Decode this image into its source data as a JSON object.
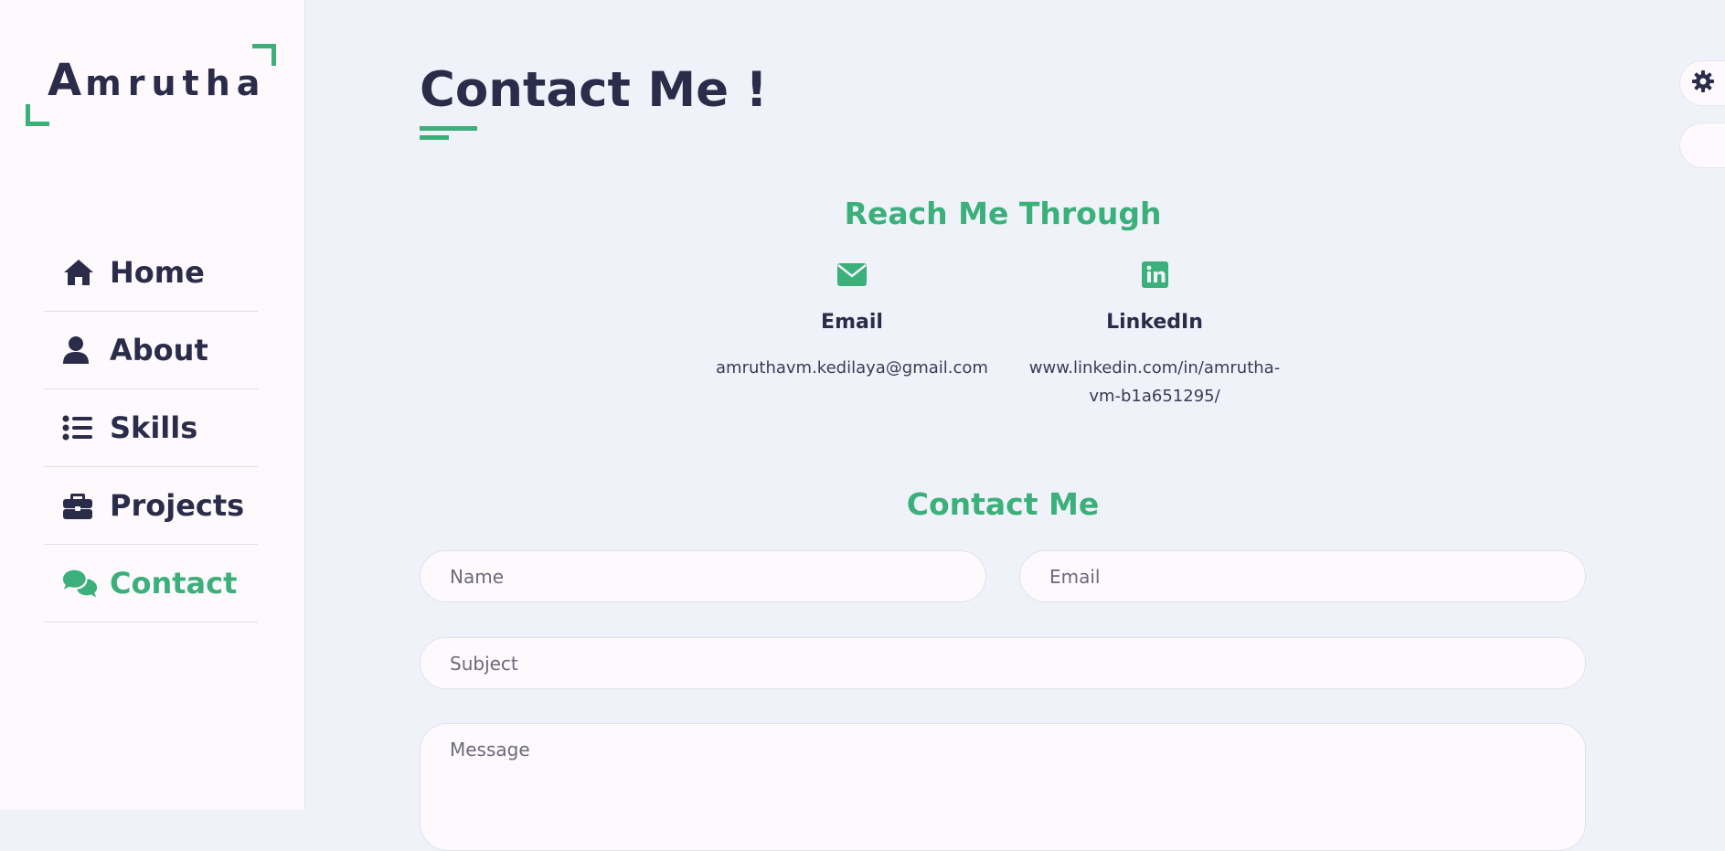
{
  "logo": {
    "first_letter": "A",
    "rest": "mrutha"
  },
  "nav": {
    "items": [
      {
        "label": "Home",
        "icon": "home-icon"
      },
      {
        "label": "About",
        "icon": "user-icon"
      },
      {
        "label": "Skills",
        "icon": "list-icon"
      },
      {
        "label": "Projects",
        "icon": "briefcase-icon"
      },
      {
        "label": "Contact",
        "icon": "comments-icon",
        "active": true
      }
    ]
  },
  "main": {
    "title": "Contact Me !",
    "reach_heading": "Reach Me Through",
    "contacts": [
      {
        "title": "Email",
        "value": "amruthavm.kedilaya@gmail.com",
        "icon": "envelope-icon"
      },
      {
        "title": "LinkedIn",
        "value_line1": "www.linkedin.com/in/amrutha-",
        "value_line2": "vm-b1a651295/",
        "icon": "linkedin-icon"
      }
    ],
    "form_heading": "Contact Me",
    "form": {
      "name_placeholder": "Name",
      "email_placeholder": "Email",
      "subject_placeholder": "Subject",
      "message_placeholder": "Message"
    }
  },
  "floating": {
    "settings_icon": "gear-icon",
    "theme_icon": "theme-toggle-icon"
  },
  "colors": {
    "accent": "#3bb07a",
    "text": "#2b2c4a",
    "background": "#f0f2fa",
    "sidebar": "#fdf9fd"
  }
}
